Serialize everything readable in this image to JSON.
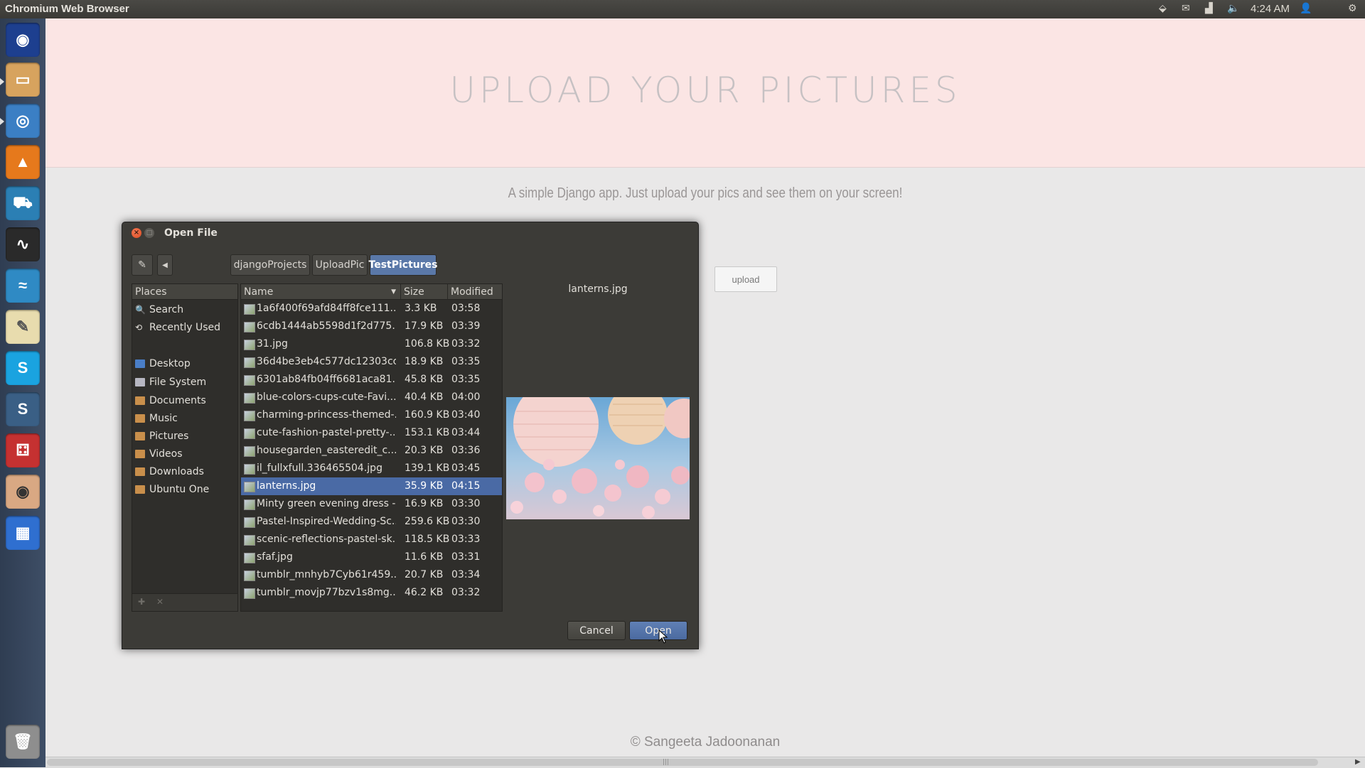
{
  "topbar": {
    "app_title": "Chromium Web Browser",
    "clock": "4:24 AM",
    "indicators": [
      "dropbox-icon",
      "mail-icon",
      "network-icon",
      "volume-icon",
      "user-icon",
      "gear-icon"
    ]
  },
  "launcher": {
    "items": [
      {
        "name": "ubuntu-home-icon",
        "color": "#1d3f8f"
      },
      {
        "name": "files-icon",
        "color": "#d7a35e"
      },
      {
        "name": "chromium-icon",
        "color": "#3b7fc4"
      },
      {
        "name": "vlc-icon",
        "color": "#e6791c"
      },
      {
        "name": "ubuntu-software-icon",
        "color": "#2b7fb4"
      },
      {
        "name": "system-monitor-icon",
        "color": "#2a2a2a"
      },
      {
        "name": "wireshark-icon",
        "color": "#2f8ac4"
      },
      {
        "name": "text-editor-icon",
        "color": "#e8dcae"
      },
      {
        "name": "skype-icon",
        "color": "#1aa3e0"
      },
      {
        "name": "sublime-icon",
        "color": "#3a5f85"
      },
      {
        "name": "dice-icon",
        "color": "#c53131"
      },
      {
        "name": "eye-icon",
        "color": "#d9a883"
      },
      {
        "name": "workspace-switcher-icon",
        "color": "#2f6fd0"
      },
      {
        "name": "trash-icon",
        "color": "#8e8e8e"
      }
    ]
  },
  "page": {
    "heading": "UPLOAD YOUR PICTURES",
    "subtitle": "A simple Django app. Just upload your pics and see them on your screen!",
    "upload_label": "upload",
    "footer": "© Sangeeta Jadoonanan"
  },
  "dialog": {
    "title": "Open File",
    "path": [
      "djangoProjects",
      "UploadPic",
      "TestPictures"
    ],
    "places_header": "Places",
    "places": [
      {
        "label": "Search",
        "icon": "search-icon"
      },
      {
        "label": "Recently Used",
        "icon": "recent-icon"
      },
      {
        "label": "Desktop",
        "icon": "desktop-icon"
      },
      {
        "label": "File System",
        "icon": "drive-icon"
      },
      {
        "label": "Documents",
        "icon": "folder-icon"
      },
      {
        "label": "Music",
        "icon": "folder-icon"
      },
      {
        "label": "Pictures",
        "icon": "folder-icon"
      },
      {
        "label": "Videos",
        "icon": "folder-icon"
      },
      {
        "label": "Downloads",
        "icon": "folder-icon"
      },
      {
        "label": "Ubuntu One",
        "icon": "folder-icon"
      }
    ],
    "columns": {
      "name": "Name",
      "size": "Size",
      "modified": "Modified"
    },
    "files": [
      {
        "name": "1a6f400f69afd84ff8fce111...",
        "size": "3.3 KB",
        "modified": "03:58"
      },
      {
        "name": "6cdb1444ab5598d1f2d775...",
        "size": "17.9 KB",
        "modified": "03:39"
      },
      {
        "name": "31.jpg",
        "size": "106.8 KB",
        "modified": "03:32"
      },
      {
        "name": "36d4be3eb4c577dc12303cc...",
        "size": "18.9 KB",
        "modified": "03:35"
      },
      {
        "name": "6301ab84fb04ff6681aca81...",
        "size": "45.8 KB",
        "modified": "03:35"
      },
      {
        "name": "blue-colors-cups-cute-Favi...",
        "size": "40.4 KB",
        "modified": "04:00"
      },
      {
        "name": "charming-princess-themed-...",
        "size": "160.9 KB",
        "modified": "03:40"
      },
      {
        "name": "cute-fashion-pastel-pretty-...",
        "size": "153.1 KB",
        "modified": "03:44"
      },
      {
        "name": "housegarden_easteredit_c...",
        "size": "20.3 KB",
        "modified": "03:36"
      },
      {
        "name": "il_fullxfull.336465504.jpg",
        "size": "139.1 KB",
        "modified": "03:45"
      },
      {
        "name": "lanterns.jpg",
        "size": "35.9 KB",
        "modified": "04:15",
        "selected": true
      },
      {
        "name": "Minty green evening dress - ...",
        "size": "16.9 KB",
        "modified": "03:30"
      },
      {
        "name": "Pastel-Inspired-Wedding-Sc...",
        "size": "259.6 KB",
        "modified": "03:30"
      },
      {
        "name": "scenic-reflections-pastel-sk...",
        "size": "118.5 KB",
        "modified": "03:33"
      },
      {
        "name": "sfaf.jpg",
        "size": "11.6 KB",
        "modified": "03:31"
      },
      {
        "name": "tumblr_mnhyb7Cyb61r459...",
        "size": "20.7 KB",
        "modified": "03:34"
      },
      {
        "name": "tumblr_movjp77bzv1s8mg...",
        "size": "46.2 KB",
        "modified": "03:32"
      }
    ],
    "preview_name": "lanterns.jpg",
    "cancel_label": "Cancel",
    "open_label": "Open"
  }
}
